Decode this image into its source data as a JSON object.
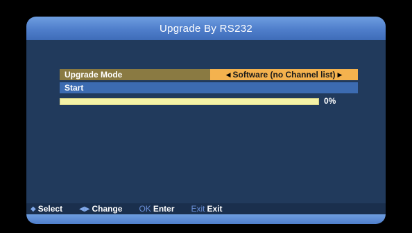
{
  "window": {
    "title": "Upgrade By RS232"
  },
  "menu": {
    "upgrade_mode_label": "Upgrade Mode",
    "upgrade_mode_value": "Software (no Channel list)",
    "left_arrow": "◀",
    "right_arrow": "▶",
    "start_label": "Start"
  },
  "progress": {
    "value": 0,
    "percent_text": "0%"
  },
  "help": {
    "select_icon": "◆",
    "select_label": "Select",
    "change_icon": "◀▶",
    "change_label": "Change",
    "ok_key": "OK",
    "ok_label": "Enter",
    "exit_key": "Exit",
    "exit_label": "Exit"
  },
  "colors": {
    "title_bar": "#5a8bd6",
    "background": "#213a5c",
    "mode_row": "#8a7a42",
    "mode_value": "#f4b24e",
    "start_row": "#3c6bb1",
    "progress_track": "#f4f2a6"
  }
}
